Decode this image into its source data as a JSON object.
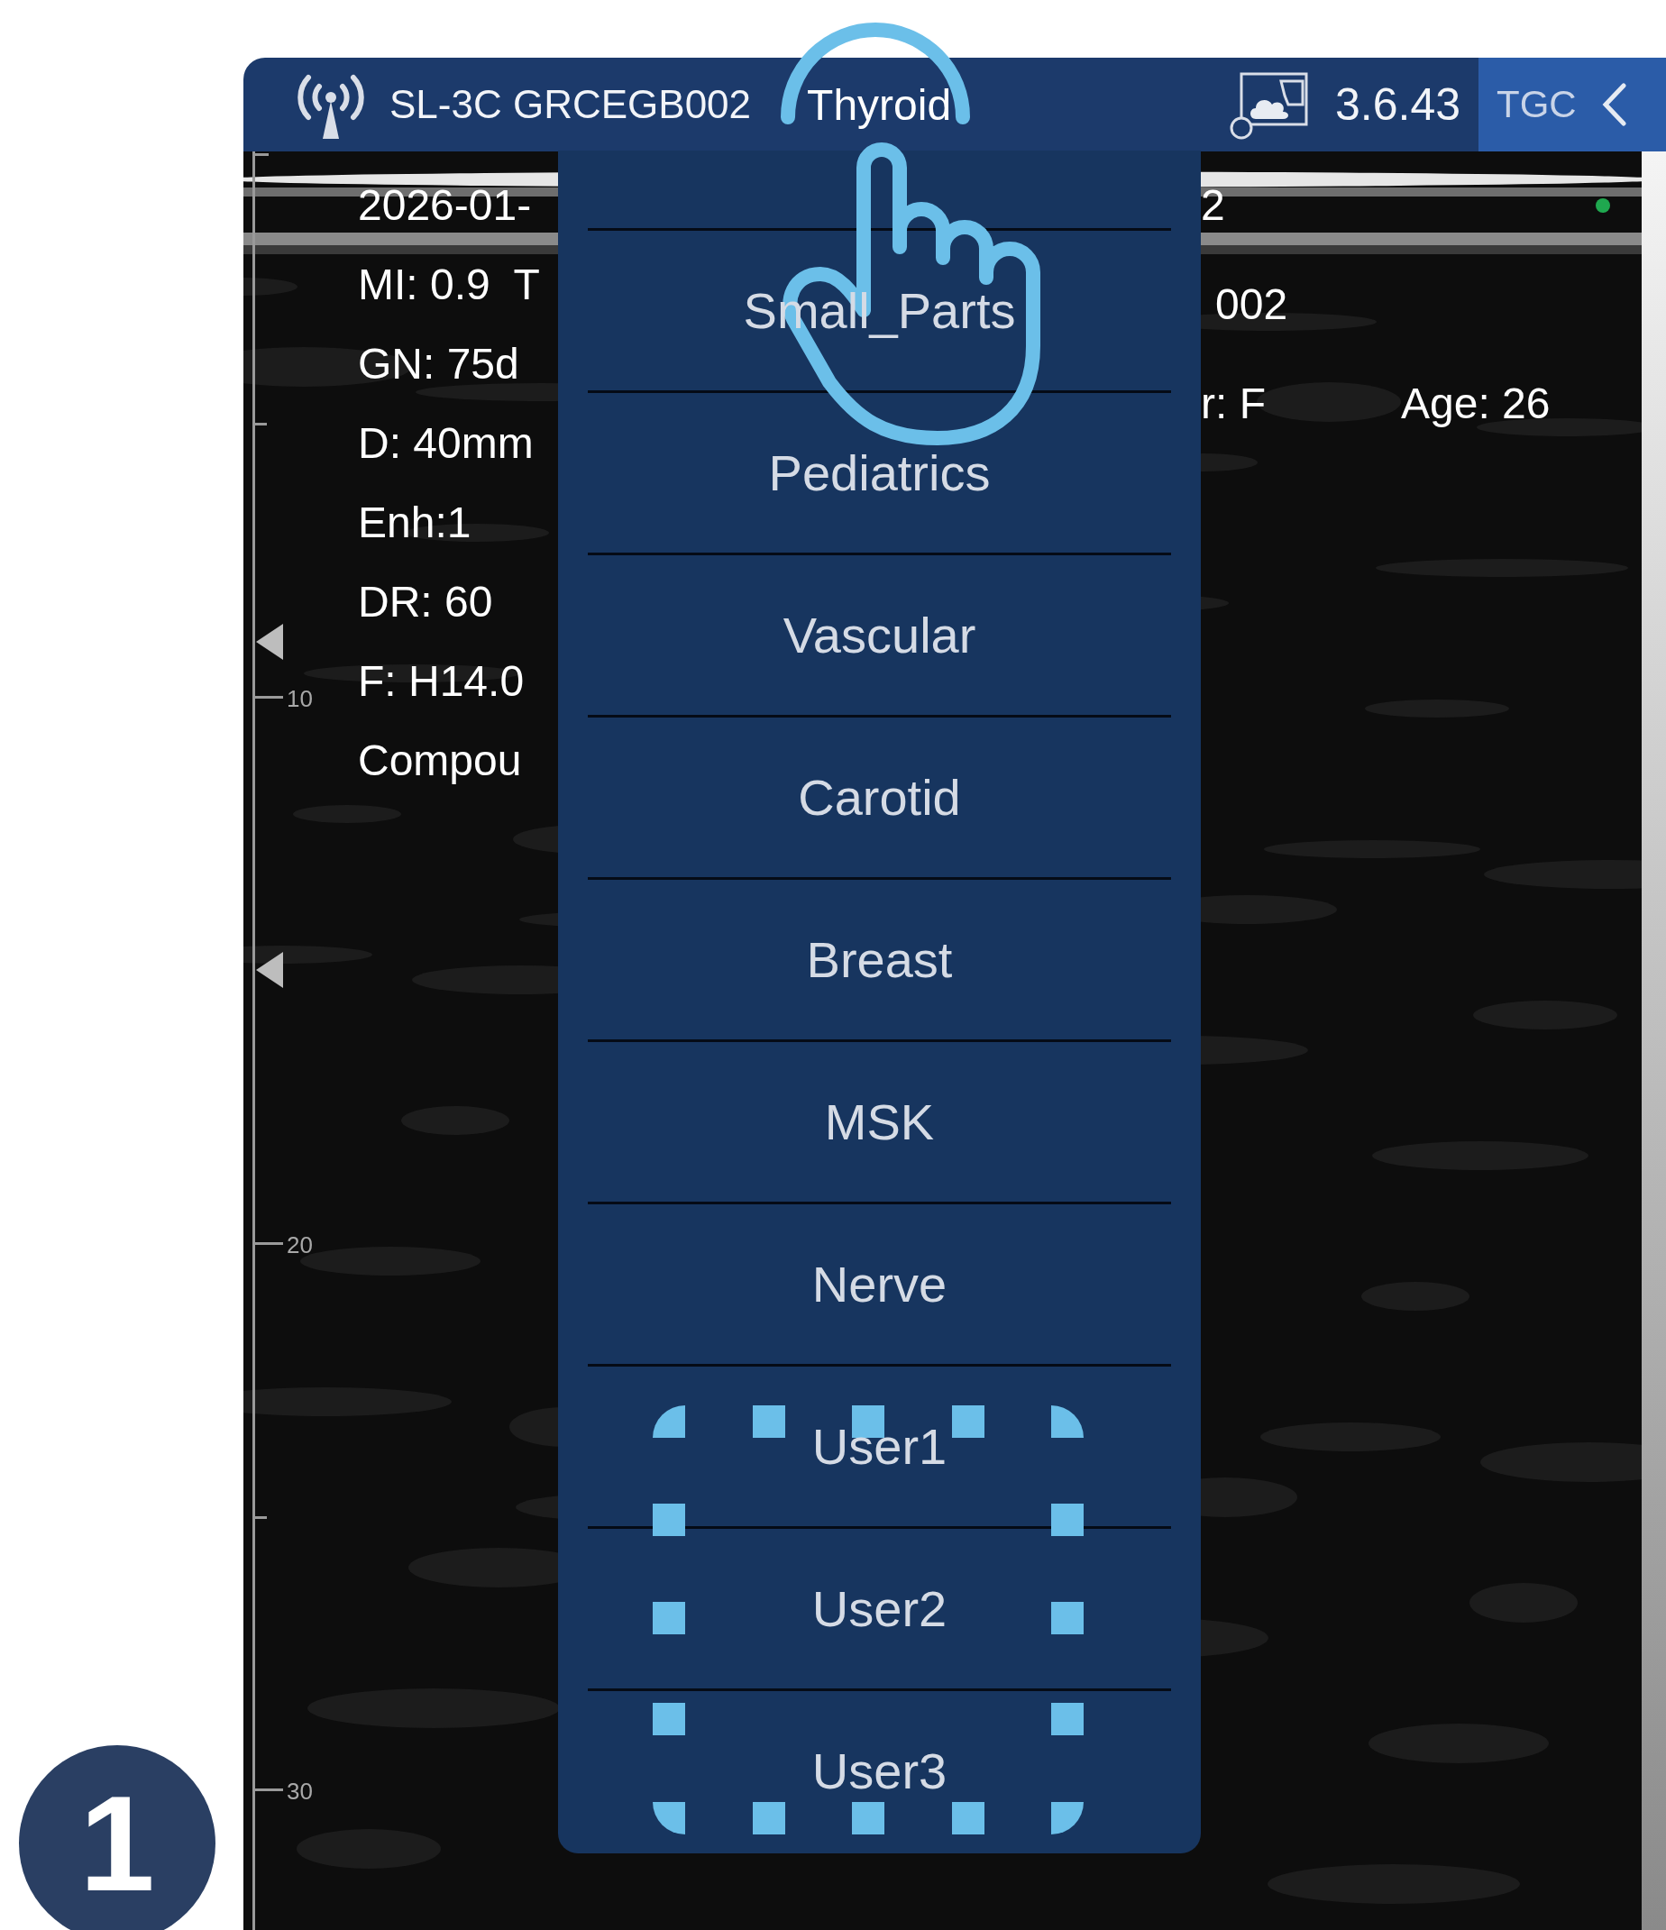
{
  "top_bar": {
    "device": "SL-3C GRCEGB002",
    "preset": "Thyroid",
    "version": "3.6.43",
    "tgc_button": "TGC"
  },
  "left_params": [
    "2026-01-",
    "MI: 0.9  T",
    "GN: 75d",
    "D: 40mm",
    "Enh:1",
    "DR: 60",
    "F: H14.0",
    "Compou"
  ],
  "right_params": [
    [
      "2"
    ],
    [
      "002"
    ],
    [
      "r: F",
      "Age: 26"
    ]
  ],
  "depth_scale": {
    "labels": [
      "10",
      "20",
      "30"
    ]
  },
  "preset_menu": {
    "items": [
      {
        "label": "Small_Parts",
        "selected": false
      },
      {
        "label": "Pediatrics",
        "selected": false
      },
      {
        "label": "Vascular",
        "selected": false
      },
      {
        "label": "Carotid",
        "selected": false
      },
      {
        "label": "Breast",
        "selected": false
      },
      {
        "label": "MSK",
        "selected": false
      },
      {
        "label": "Nerve",
        "selected": false
      },
      {
        "label": "User1",
        "selected": false
      },
      {
        "label": "User2",
        "selected": false
      },
      {
        "label": "User3",
        "selected": false
      }
    ]
  },
  "step_badge": "1"
}
